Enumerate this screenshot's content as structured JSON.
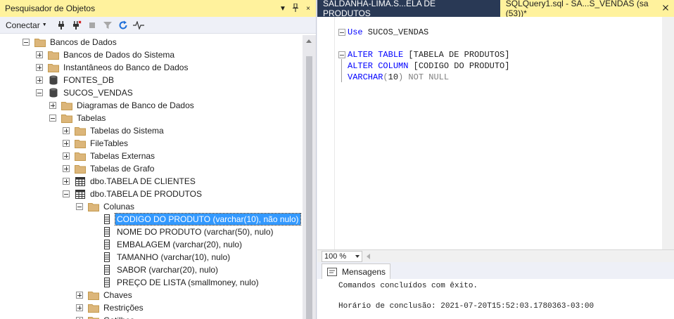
{
  "object_explorer": {
    "title": "Pesquisador de Objetos",
    "title_controls": [
      "▼",
      "☉",
      "×"
    ],
    "toolbar": {
      "connect_label": "Conectar"
    },
    "tree": [
      {
        "label": "Bancos de Dados",
        "expander": "minus",
        "icon": "folder-icon"
      },
      {
        "label": "Bancos de Dados do Sistema",
        "expander": "plus",
        "icon": "folder-icon"
      },
      {
        "label": "Instantâneos do Banco de Dados",
        "expander": "plus",
        "icon": "folder-icon"
      },
      {
        "label": "FONTES_DB",
        "expander": "plus",
        "icon": "database-icon"
      },
      {
        "label": "SUCOS_VENDAS",
        "expander": "minus",
        "icon": "database-icon"
      },
      {
        "label": "Diagramas de Banco de Dados",
        "expander": "plus",
        "icon": "folder-icon"
      },
      {
        "label": "Tabelas",
        "expander": "minus",
        "icon": "folder-icon"
      },
      {
        "label": "Tabelas do Sistema",
        "expander": "plus",
        "icon": "folder-icon"
      },
      {
        "label": "FileTables",
        "expander": "plus",
        "icon": "folder-icon"
      },
      {
        "label": "Tabelas Externas",
        "expander": "plus",
        "icon": "folder-icon"
      },
      {
        "label": "Tabelas de Grafo",
        "expander": "plus",
        "icon": "folder-icon"
      },
      {
        "label": "dbo.TABELA DE CLIENTES",
        "expander": "plus",
        "icon": "table-icon"
      },
      {
        "label": "dbo.TABELA DE PRODUTOS",
        "expander": "minus",
        "icon": "table-icon"
      },
      {
        "label": "Colunas",
        "expander": "minus",
        "icon": "folder-icon"
      },
      {
        "label": "CODIGO DO PRODUTO (varchar(10), não nulo)",
        "expander": "none",
        "icon": "column-icon",
        "selected": true
      },
      {
        "label": "NOME DO PRODUTO (varchar(50), nulo)",
        "expander": "none",
        "icon": "column-icon"
      },
      {
        "label": "EMBALAGEM (varchar(20), nulo)",
        "expander": "none",
        "icon": "column-icon"
      },
      {
        "label": "TAMANHO (varchar(10), nulo)",
        "expander": "none",
        "icon": "column-icon"
      },
      {
        "label": "SABOR (varchar(20), nulo)",
        "expander": "none",
        "icon": "column-icon"
      },
      {
        "label": "PREÇO DE LISTA (smallmoney, nulo)",
        "expander": "none",
        "icon": "column-icon"
      },
      {
        "label": "Chaves",
        "expander": "plus",
        "icon": "folder-icon"
      },
      {
        "label": "Restrições",
        "expander": "plus",
        "icon": "folder-icon"
      },
      {
        "label": "Gatilhos",
        "expander": "plus",
        "icon": "folder-icon"
      }
    ]
  },
  "editor": {
    "tabs": [
      {
        "label": "SALDANHA-LIMA.S...ELA DE PRODUTOS",
        "active": false
      },
      {
        "label": "SQLQuery1.sql - SA...S_VENDAS (sa (53))*",
        "active": true
      }
    ],
    "code": {
      "line1_kw": "Use",
      "line1_rest": " SUCOS_VENDAS",
      "line2_kw1": "ALTER",
      "line2_kw2": "TABLE",
      "line2_rest": " [TABELA DE PRODUTOS]",
      "line3_kw1": "ALTER",
      "line3_kw2": "COLUMN",
      "line3_rest": " [CODIGO DO PRODUTO]",
      "line4_kw": "VARCHAR",
      "line4_open": "(",
      "line4_num": "10",
      "line4_close": ")",
      "line4_rest": " NOT NULL"
    },
    "zoom": "100 %",
    "results": {
      "tab_label": "Mensagens",
      "line1": "Comandos concluídos com êxito.",
      "line2": "Horário de conclusão: 2021-07-20T15:52:03.1780363-03:00"
    }
  },
  "colors": {
    "title_active": "#fff29d",
    "tab_bar": "#293955",
    "selection": "#3399ff",
    "keyword": "#0000ff",
    "gray_text": "#808080"
  }
}
